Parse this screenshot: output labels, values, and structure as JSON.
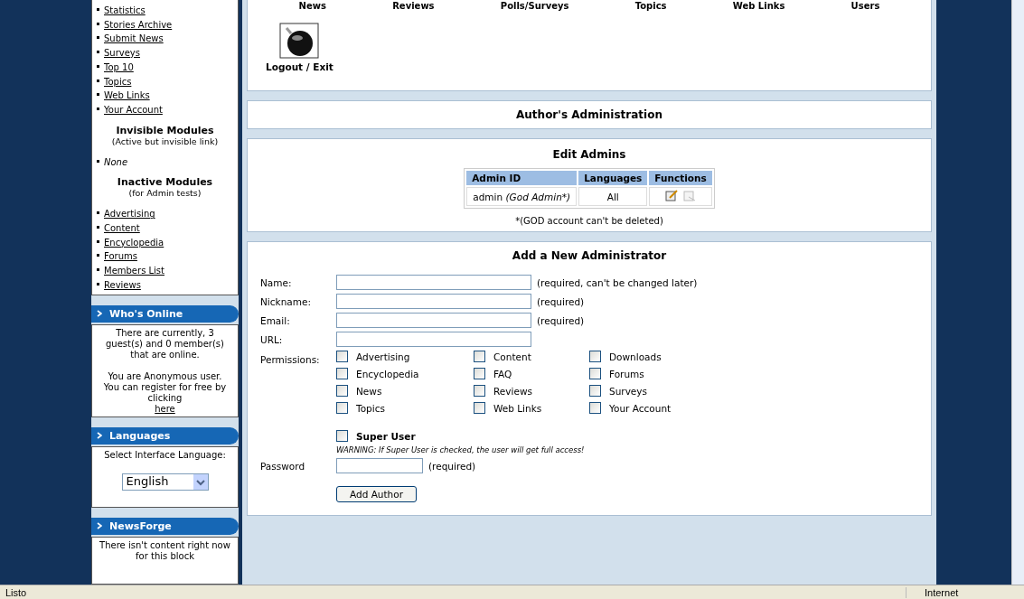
{
  "top_nav": {
    "items": [
      "News",
      "Reviews",
      "Polls/Surveys",
      "Topics",
      "Web Links",
      "Users"
    ]
  },
  "logout": {
    "label": "Logout / Exit"
  },
  "sidebar": {
    "modules": [
      "Statistics",
      "Stories Archive",
      "Submit News",
      "Surveys",
      "Top 10",
      "Topics",
      "Web Links",
      "Your Account"
    ],
    "invisible_heading": "Invisible Modules",
    "invisible_note": "(Active but invisible link)",
    "invisible_items": [
      "None"
    ],
    "inactive_heading": "Inactive Modules",
    "inactive_note": "(for Admin tests)",
    "inactive_items": [
      "Advertising",
      "Content",
      "Encyclopedia",
      "Forums",
      "Members List",
      "Reviews"
    ],
    "blocks": [
      {
        "kind": "online",
        "title": "Who's Online",
        "text": "There are currently, 3 guest(s) and 0 member(s) that are online.",
        "text2": "You are Anonymous user. You can register for free by clicking",
        "link": "here"
      },
      {
        "kind": "language",
        "title": "Languages",
        "text": "Select Interface Language:",
        "select": "English"
      },
      {
        "kind": "text",
        "title": "NewsForge",
        "text": "There isn't content right now for this block"
      }
    ]
  },
  "authors_title": "Author's Administration",
  "edit_admins": {
    "title": "Edit Admins",
    "columns": [
      "Admin ID",
      "Languages",
      "Functions"
    ],
    "rows": [
      {
        "id": "admin",
        "note": "(God Admin*)",
        "languages": "All"
      }
    ],
    "footnote": "*(GOD account can't be deleted)"
  },
  "new_admin": {
    "title": "Add a New Administrator",
    "fields": [
      {
        "label": "Name:",
        "hint": "(required, can't be changed later)"
      },
      {
        "label": "Nickname:",
        "hint": "(required)"
      },
      {
        "label": "Email:",
        "hint": "(required)"
      },
      {
        "label": "URL:"
      }
    ],
    "permissions_label": "Permissions:",
    "permissions": [
      {
        "label": "Advertising",
        "checked": false
      },
      {
        "label": "Content",
        "checked": false
      },
      {
        "label": "Downloads",
        "checked": false
      },
      {
        "label": "Encyclopedia",
        "checked": false
      },
      {
        "label": "FAQ",
        "checked": false
      },
      {
        "label": "Forums",
        "checked": false
      },
      {
        "label": "News",
        "checked": false
      },
      {
        "label": "Reviews",
        "checked": false
      },
      {
        "label": "Surveys",
        "checked": false
      },
      {
        "label": "Topics",
        "checked": false
      },
      {
        "label": "Web Links",
        "checked": false
      },
      {
        "label": "Your Account",
        "checked": false
      }
    ],
    "super_user": {
      "label": "Super User",
      "checked": false
    },
    "warning": "WARNING: If Super User is checked, the user will get full access!",
    "password": {
      "label": "Password",
      "hint": "(required)"
    },
    "submit": "Add Author"
  },
  "status_bar": {
    "text": "Listo",
    "zone": "Internet"
  }
}
